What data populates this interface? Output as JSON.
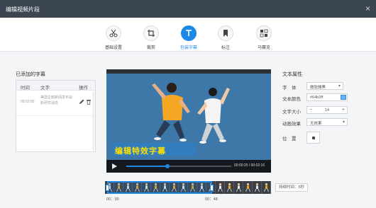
{
  "window": {
    "title": "编辑视频片段",
    "close_icon": "×"
  },
  "toolbar": {
    "items": [
      {
        "label": "基础设置",
        "icon": "scissors-icon",
        "active": false
      },
      {
        "label": "裁剪",
        "icon": "crop-icon",
        "active": false
      },
      {
        "label": "包装字幕",
        "icon": "text-icon",
        "active": true
      },
      {
        "label": "标注",
        "icon": "bookmark-icon",
        "active": false
      },
      {
        "label": "马赛克",
        "icon": "mosaic-icon",
        "active": false
      }
    ]
  },
  "subtitles": {
    "panel_title": "已添加的字幕",
    "columns": {
      "time": "时间",
      "text": "文字",
      "action": "操作"
    },
    "rows": [
      {
        "time": "00:52:00",
        "text": "美国企鹅新闻发布会新研究消息"
      }
    ]
  },
  "video": {
    "caption": "编辑特效字幕",
    "current_time": "00:00:25",
    "total_time": "00:02:16",
    "timecode": "00:00:25 / 00:02:16",
    "progress": 0.39
  },
  "text_props": {
    "title": "文本属性",
    "font_label": "字　体",
    "font_value": "微软雅黑",
    "color_label": "文本颜色",
    "color_value": "#64b2ff",
    "size_label": "文字大小",
    "size_value": "14",
    "size_minus": "−",
    "size_plus": "+",
    "effect_label": "动画效果",
    "effect_value": "无效果",
    "position_label": "位　置"
  },
  "timeline": {
    "start_label": "00：00",
    "end_label": "00：48",
    "duration_label": "持续时间：5秒"
  },
  "colors": {
    "accent": "#1e88e5",
    "titlebar": "#3c4653",
    "caption": "#ffe100"
  }
}
